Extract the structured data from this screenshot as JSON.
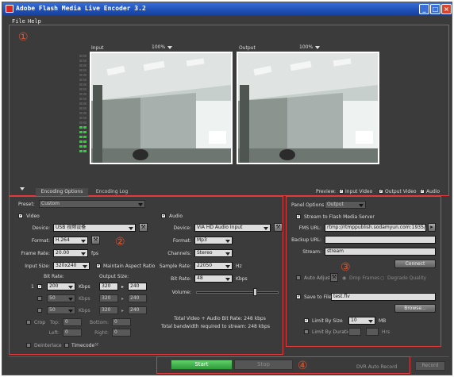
{
  "window": {
    "title": "Adobe Flash Media Live Encoder 3.2",
    "min": "_",
    "max": "□",
    "close": "×"
  },
  "menu": {
    "file": "File",
    "help": "Help"
  },
  "annotations": {
    "a1": "①",
    "a2": "②",
    "a3": "③",
    "a4": "④"
  },
  "preview": {
    "input_label": "Input",
    "input_zoom": "100%",
    "output_label": "Output",
    "output_zoom": "100%"
  },
  "tabs": {
    "encoding_options": "Encoding Options",
    "encoding_log": "Encoding Log"
  },
  "preview_opts": {
    "label": "Preview:",
    "input_video": "Input Video",
    "output_video": "Output Video",
    "audio": "Audio"
  },
  "preset": {
    "label": "Preset:",
    "value": "Custom"
  },
  "video": {
    "title": "Video",
    "device_label": "Device:",
    "device": "USB 视频设备",
    "format_label": "Format:",
    "format": "H.264",
    "framerate_label": "Frame Rate:",
    "framerate": "20.00",
    "fps": "fps",
    "input_size_label": "Input Size:",
    "input_size": "320x240",
    "maintain_aspect": "Maintain Aspect Ratio",
    "bitrate_label": "Bit Rate:",
    "output_size_label": "Output Size:",
    "row1_index": "1",
    "row1_bitrate": "200",
    "row1_unit": "Kbps",
    "row1_w": "320",
    "row1_h": "240",
    "row2_bitrate": "50",
    "row2_unit": "Kbps",
    "row2_w": "320",
    "row2_h": "240",
    "row3_bitrate": "50",
    "row3_unit": "Kbps",
    "row3_w": "320",
    "row3_h": "240",
    "crop": "Crop",
    "top": "Top:",
    "bottom": "Bottom:",
    "left": "Left:",
    "right": "Right:",
    "crop_top": "0",
    "crop_bottom": "0",
    "crop_left": "0",
    "crop_right": "0",
    "deinterlace": "Deinterlace",
    "timecode": "Timecode"
  },
  "audio": {
    "title": "Audio",
    "device_label": "Device:",
    "device": "VIA HD Audio Input",
    "format_label": "Format:",
    "format": "Mp3",
    "channels_label": "Channels:",
    "channels": "Stereo",
    "samplerate_label": "Sample Rate:",
    "samplerate": "22050",
    "hz": "Hz",
    "bitrate_label": "Bit Rate:",
    "bitrate": "48",
    "kbps": "Kbps",
    "volume_label": "Volume:",
    "volume_level": 0.72
  },
  "totals": {
    "line1": "Total Video + Audio Bit Rate:  248 kbps",
    "line2": "Total bandwidth required to stream:  248 kbps"
  },
  "panel": {
    "options_label": "Panel Options:",
    "options_value": "Output",
    "stream_fms": "Stream to Flash Media Server",
    "fms_url_label": "FMS URL:",
    "fms_url": "rtmp://rtmppublish.sodamyun.com:1935/",
    "backup_url_label": "Backup URL:",
    "backup_url": "",
    "stream_label": "Stream:",
    "stream_value": "stream",
    "connect": "Connect",
    "auto_adjust": "Auto Adjust",
    "drop_frames": "Drop Frames",
    "degrade_quality": "Degrade Quality",
    "save_to_file": "Save to File",
    "file_name": "test.flv",
    "browse": "Browse...",
    "limit_size": "Limit By Size",
    "size_value": "10",
    "mb": "MB",
    "limit_duration": "Limit By Duration",
    "hrs": "Hrs"
  },
  "footer": {
    "start": "Start",
    "stop": "Stop",
    "dvr": "DVR Auto Record",
    "record": "Record"
  }
}
